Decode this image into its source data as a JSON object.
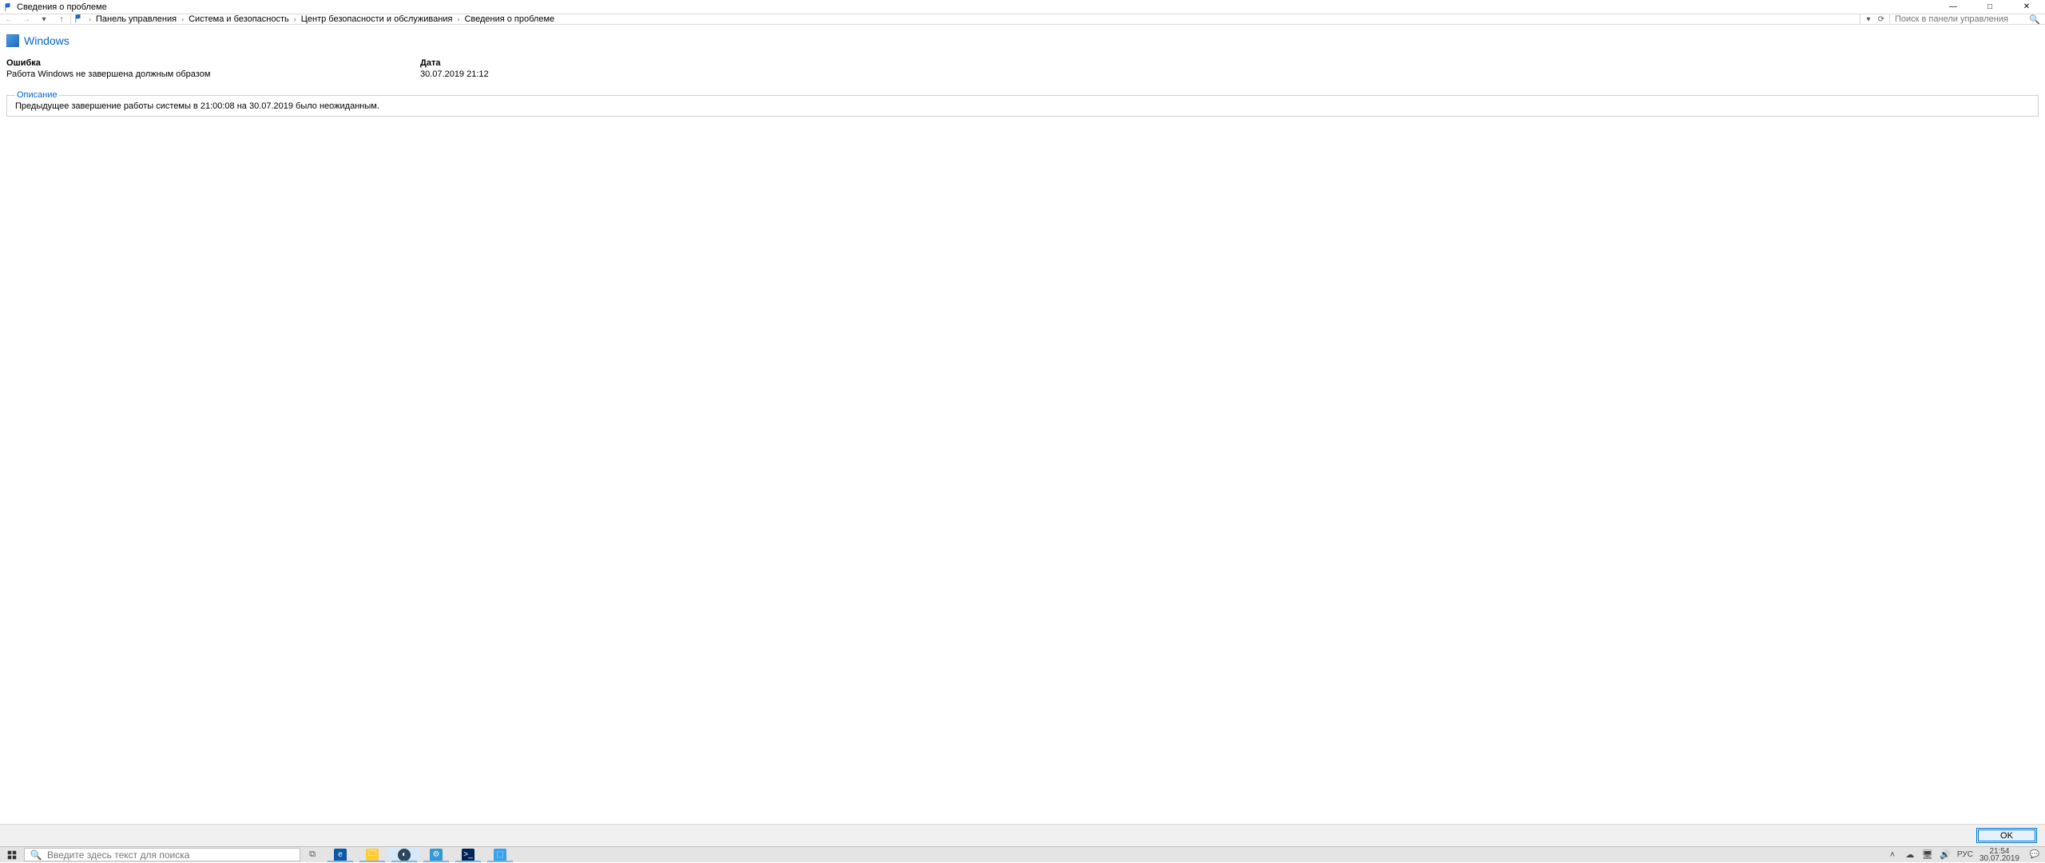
{
  "window": {
    "title": "Сведения о проблеме",
    "controls": {
      "min": "—",
      "max": "□",
      "close": "✕"
    }
  },
  "nav": {
    "back": "←",
    "forward": "→",
    "recent": "▾",
    "up": "↑",
    "breadcrumbs": [
      "Панель управления",
      "Система и безопасность",
      "Центр безопасности и обслуживания",
      "Сведения о проблеме"
    ],
    "dropdown": "▾",
    "refresh": "⟳",
    "search_placeholder": "Поиск в панели управления"
  },
  "page": {
    "heading": "Windows",
    "error_label": "Ошибка",
    "error_value": "Работа Windows не завершена должным образом",
    "date_label": "Дата",
    "date_value": "30.07.2019 21:12",
    "desc_label": "Описание",
    "desc_value": "Предыдущее завершение работы системы в 21:00:08 на 30.07.2019 было неожиданным."
  },
  "cmdbar": {
    "ok": "OK"
  },
  "taskbar": {
    "search_placeholder": "Введите здесь текст для поиска",
    "tray": {
      "up": "˄",
      "cloud": "☁",
      "net": "🖥",
      "vol": "🔊",
      "lang": "РУС",
      "time": "21:54",
      "date": "30.07.2019",
      "notif": "💬"
    }
  }
}
